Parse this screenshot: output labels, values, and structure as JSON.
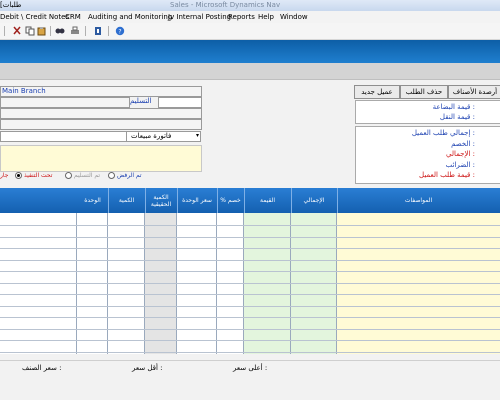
{
  "window": {
    "title": "[طلبات",
    "title_faded": "Sales - Microsoft Dynamics Nav"
  },
  "menu": [
    "Debit \\ Credit Notes",
    "CRM",
    "Auditing and Monitoring",
    "Jv Internal Posting",
    "Reports",
    "Help",
    "Window"
  ],
  "toolbar": {
    "icons": [
      "menu-icon",
      "cut-icon",
      "copy-icon",
      "paste-icon",
      "find-icon",
      "print-icon",
      "exit-icon",
      "help-icon"
    ]
  },
  "form": {
    "branch": "Main Branch",
    "delivery_label": "التسليم",
    "doc_type": "فاتورة مبيعات",
    "radio_options": [
      "تحت التنفيذ",
      "تم التسليم",
      "تم الرفض"
    ],
    "radio_left": "جار"
  },
  "buttons": {
    "stock_balance": "أرصدة الأصناف",
    "delete_order": "حذف الطلب",
    "new_customer": "عميل جديد"
  },
  "info": {
    "goods_value": "قيمة البضاعة :",
    "shipping_value": "قيمة النقل :"
  },
  "totals": {
    "order_total": "إجمالي طلب العميل :",
    "discount": "الخصم :",
    "total": "الإجمالي :",
    "taxes": "الضرائب :",
    "order_value": "قيمة طلب العميل :"
  },
  "grid": {
    "headers": [
      "الوحدة",
      "الكمية",
      "الكمية الحقيقية",
      "سعر الوحدة",
      "% خصم",
      "القيمة",
      "الإجمالي",
      "المواصفات"
    ]
  },
  "status": {
    "item_price": "سعر الصنف :",
    "min_price": "أقل سعر :",
    "max_price": "أعلى سعر :"
  },
  "colors": {
    "banner": "#1a6fc0",
    "grid_header": "#2a7ed4",
    "value_col": "#e3f5dd",
    "spec_col": "#fffbd6"
  }
}
